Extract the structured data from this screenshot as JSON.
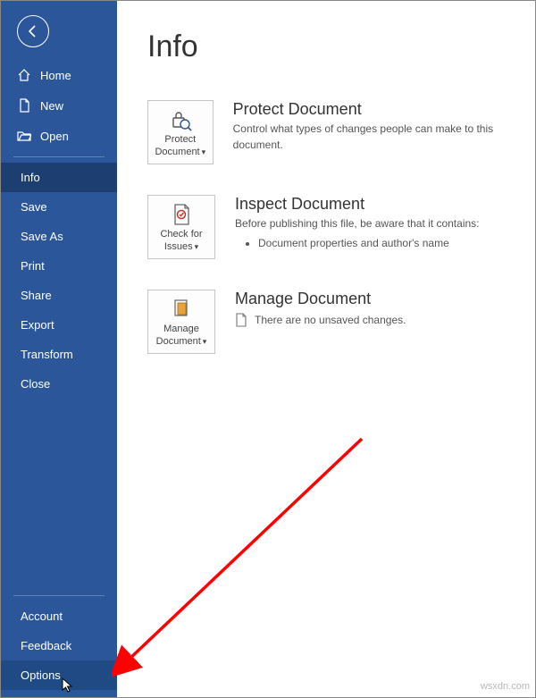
{
  "sidebar": {
    "top": [
      {
        "label": "Home",
        "icon": "home"
      },
      {
        "label": "New",
        "icon": "new"
      },
      {
        "label": "Open",
        "icon": "open"
      }
    ],
    "mid": [
      {
        "label": "Info",
        "selected": true
      },
      {
        "label": "Save"
      },
      {
        "label": "Save As"
      },
      {
        "label": "Print"
      },
      {
        "label": "Share"
      },
      {
        "label": "Export"
      },
      {
        "label": "Transform"
      },
      {
        "label": "Close"
      }
    ],
    "bottom": [
      {
        "label": "Account"
      },
      {
        "label": "Feedback"
      },
      {
        "label": "Options",
        "hover": true
      }
    ]
  },
  "page": {
    "title": "Info"
  },
  "sections": {
    "protect": {
      "button_line1": "Protect",
      "button_line2": "Document",
      "heading": "Protect Document",
      "desc": "Control what types of changes people can make to this document."
    },
    "inspect": {
      "button_line1": "Check for",
      "button_line2": "Issues",
      "heading": "Inspect Document",
      "desc_intro": "Before publishing this file, be aware that it contains:",
      "bullet1": "Document properties and author's name"
    },
    "manage": {
      "button_line1": "Manage",
      "button_line2": "Document",
      "heading": "Manage Document",
      "history_text": "There are no unsaved changes."
    }
  },
  "watermark": "wsxdn.com"
}
